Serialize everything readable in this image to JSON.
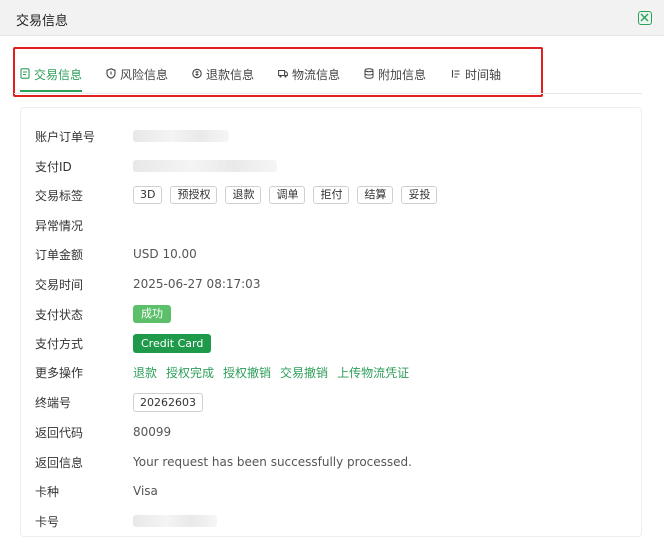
{
  "window": {
    "title": "交易信息"
  },
  "tabs": [
    {
      "label": "交易信息",
      "icon": "receipt-icon"
    },
    {
      "label": "风险信息",
      "icon": "shield-icon"
    },
    {
      "label": "退款信息",
      "icon": "refund-icon"
    },
    {
      "label": "物流信息",
      "icon": "truck-icon"
    },
    {
      "label": "附加信息",
      "icon": "database-icon"
    },
    {
      "label": "时间轴",
      "icon": "timeline-icon"
    }
  ],
  "fields": {
    "order_no": {
      "label": "账户订单号"
    },
    "payment_id": {
      "label": "支付ID"
    },
    "tags": {
      "label": "交易标签",
      "items": [
        "3D",
        "预授权",
        "退款",
        "调单",
        "拒付",
        "结算",
        "妥投"
      ]
    },
    "exception": {
      "label": "异常情况"
    },
    "amount": {
      "label": "订单金额",
      "value": "USD 10.00"
    },
    "time": {
      "label": "交易时间",
      "value": "2025-06-27 08:17:03"
    },
    "status": {
      "label": "支付状态",
      "value": "成功"
    },
    "method": {
      "label": "支付方式",
      "value": "Credit Card"
    },
    "actions": {
      "label": "更多操作",
      "items": [
        "退款",
        "授权完成",
        "授权撤销",
        "交易撤销",
        "上传物流凭证"
      ]
    },
    "terminal": {
      "label": "终端号",
      "value": "20262603"
    },
    "return_code": {
      "label": "返回代码",
      "value": "80099"
    },
    "return_msg": {
      "label": "返回信息",
      "value": "Your request has been successfully processed."
    },
    "card_type": {
      "label": "卡种",
      "value": "Visa"
    },
    "card_no": {
      "label": "卡号"
    }
  },
  "colors": {
    "accent": "#2e9e5b",
    "success": "#5cc06a",
    "brand_badge": "#1f9a4a",
    "highlight_border": "#e02020"
  }
}
